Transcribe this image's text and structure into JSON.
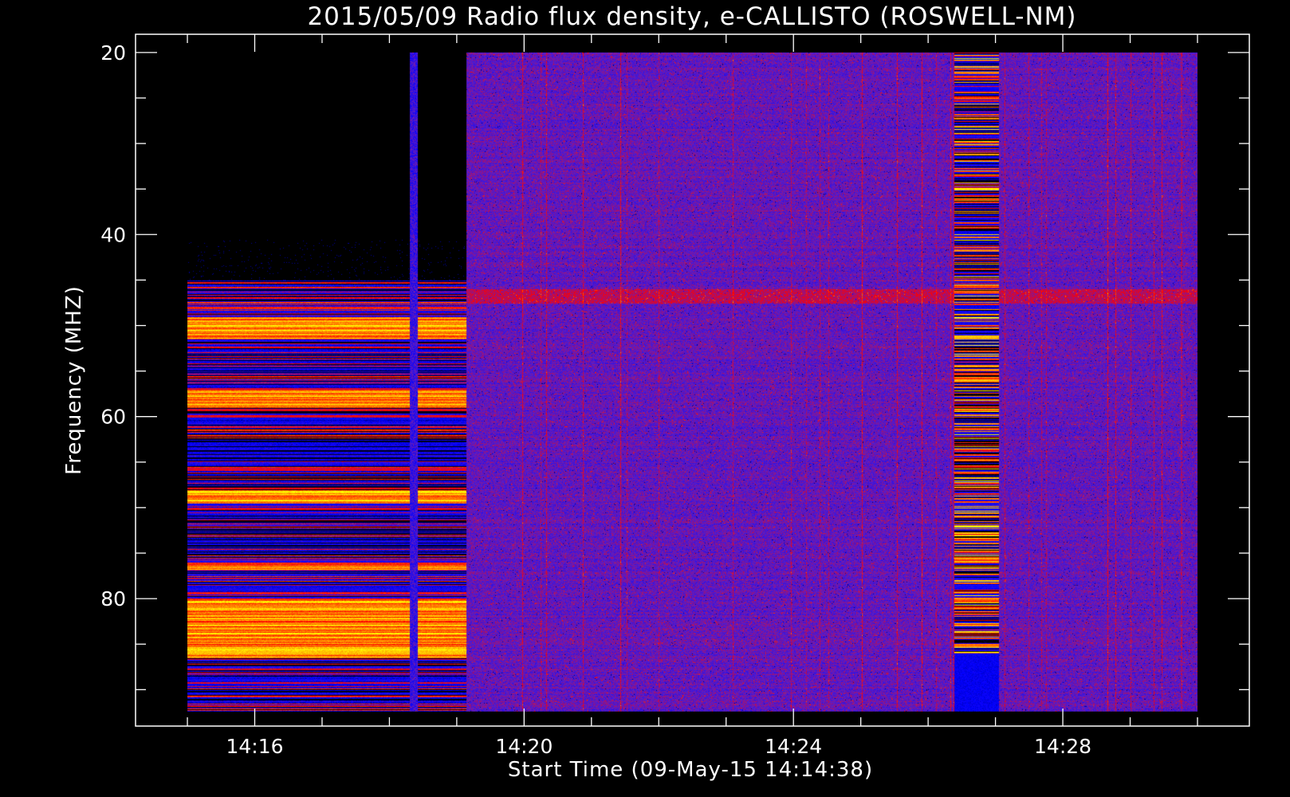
{
  "chart_data": {
    "type": "heatmap",
    "title": "2015/05/09  Radio flux density, e-CALLISTO (ROSWELL-NM)",
    "xlabel": "Start Time (09-May-15 14:14:38)",
    "ylabel": "Frequency (MHZ)",
    "x_range_minutes": [
      14.23,
      30.77
    ],
    "x_data_range_minutes": [
      15.0,
      30.0
    ],
    "y_range_mhz": [
      18,
      94
    ],
    "y_data_range_mhz": [
      20,
      92.4
    ],
    "y_inverted": true,
    "x_tick_labels": [
      "14:16",
      "14:20",
      "14:24",
      "14:28"
    ],
    "x_major_ticks_minutes": [
      16,
      20,
      24,
      28
    ],
    "x_minor_step_minutes": 1,
    "y_tick_labels": [
      "20",
      "40",
      "60",
      "80"
    ],
    "y_major_ticks_mhz": [
      20,
      40,
      60,
      80
    ],
    "y_minor_step_mhz": 5,
    "colormap": [
      "#000000",
      "#0000ff",
      "#5a1ec8",
      "#ff0000",
      "#ff8000",
      "#ffff00"
    ],
    "features": [
      {
        "kind": "pre-calibration block",
        "t_start": "14:15:00",
        "t_end": "14:19:08",
        "freq_mhz": [
          45,
          92.4
        ],
        "bright_bands_mhz": [
          [
            49,
            51.5
          ],
          [
            57,
            59
          ],
          [
            68,
            69.5
          ],
          [
            76,
            76.8
          ],
          [
            80,
            86.5
          ]
        ]
      },
      {
        "kind": "vertical artifact",
        "t_start": "14:18:18",
        "t_end": "14:18:25",
        "freq_mhz": [
          20,
          92.4
        ]
      },
      {
        "kind": "interference burst",
        "t_start": "14:26:23",
        "t_end": "14:27:03",
        "freq_mhz": [
          20,
          86
        ]
      },
      {
        "kind": "persistent RFI band",
        "freq_mhz": [
          46,
          47.5
        ]
      }
    ]
  }
}
